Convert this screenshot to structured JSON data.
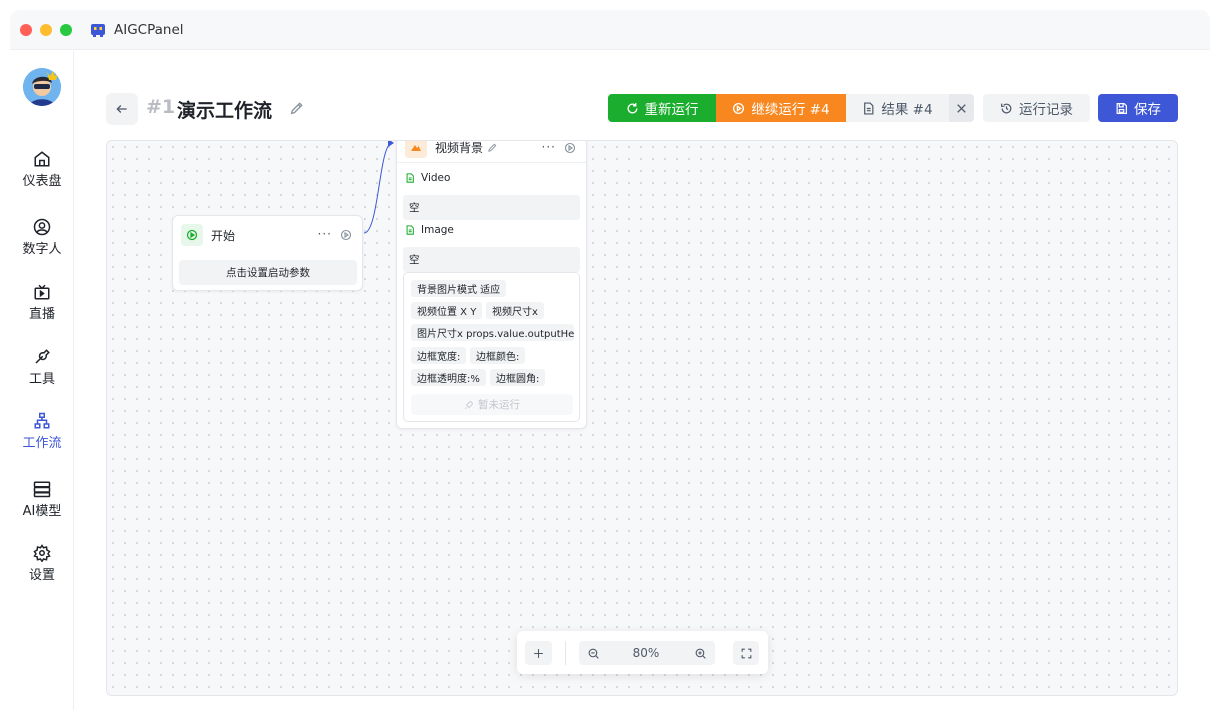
{
  "app": {
    "title": "AIGCPanel"
  },
  "sidebar": {
    "items": [
      {
        "label": "仪表盘",
        "icon": "home-icon"
      },
      {
        "label": "数字人",
        "icon": "user-circle-icon"
      },
      {
        "label": "直播",
        "icon": "tv-icon"
      },
      {
        "label": "工具",
        "icon": "wrench-icon"
      },
      {
        "label": "工作流",
        "icon": "workflow-icon",
        "active": true
      },
      {
        "label": "AI模型",
        "icon": "server-icon"
      },
      {
        "label": "设置",
        "icon": "gear-icon"
      }
    ]
  },
  "workflow": {
    "index": "#1",
    "title": "演示工作流"
  },
  "toolbar": {
    "rerun": "重新运行",
    "continue": "继续运行 #4",
    "result": "结果 #4",
    "history": "运行记录",
    "save": "保存"
  },
  "nodes": {
    "start": {
      "title": "开始",
      "more": "···",
      "param_button": "点击设置启动参数"
    },
    "video": {
      "title": "视频背景",
      "more": "···",
      "ports": [
        {
          "label": "Video",
          "value": "空"
        },
        {
          "label": "Image",
          "value": "空"
        }
      ],
      "tags": [
        "背景图片模式 适应",
        "视频位置 X Y",
        "视频尺寸x",
        "图片尺寸x props.value.outputHeight",
        "边框宽度:",
        "边框颜色:",
        "边框透明度:%",
        "边框圆角:"
      ],
      "status": "暂未运行"
    }
  },
  "zoom": {
    "level": "80%"
  },
  "colors": {
    "primary": "#3d57d6",
    "rerun": "#1aad2e",
    "continue": "#f7871e"
  }
}
